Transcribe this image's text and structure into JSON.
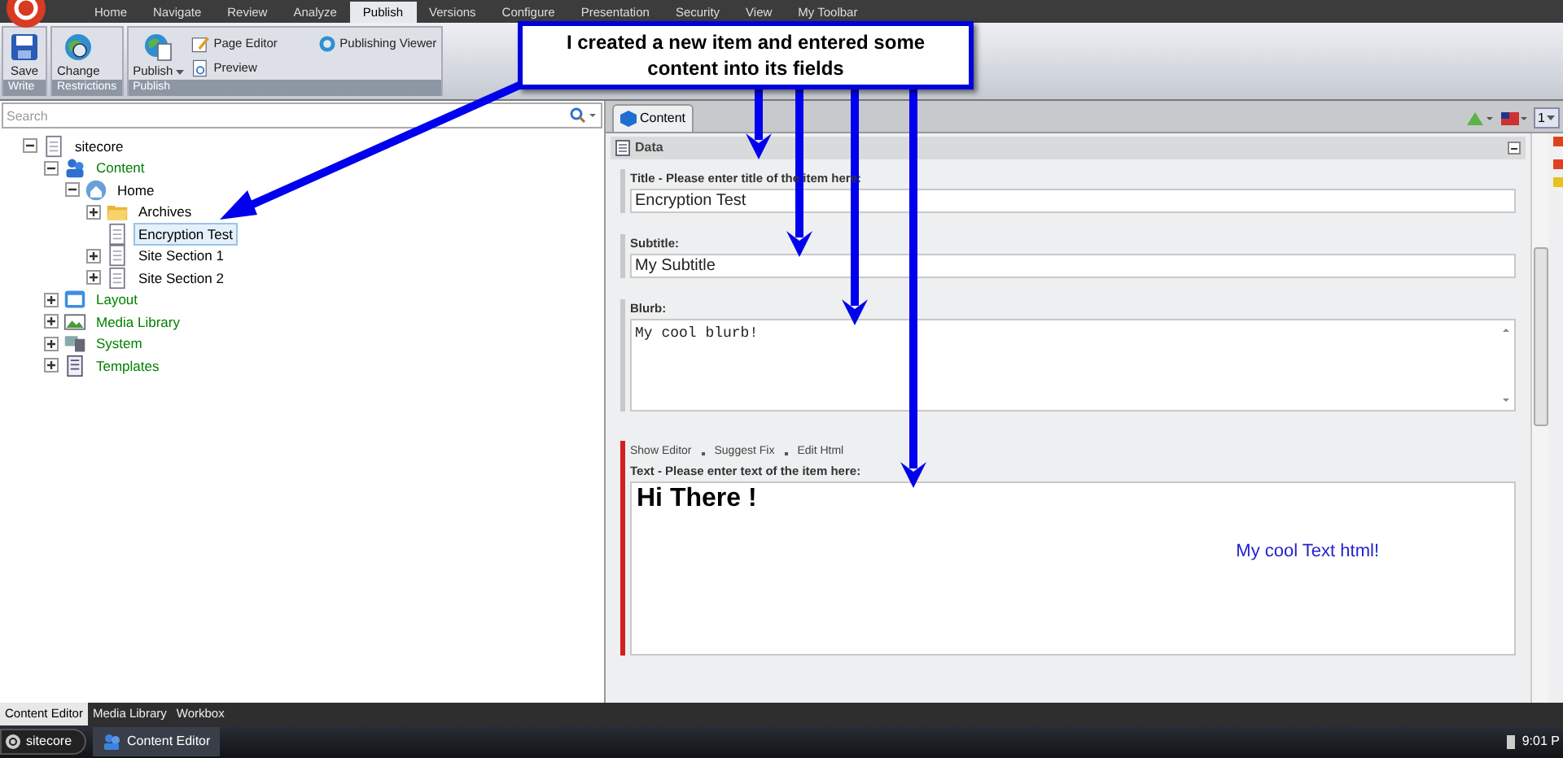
{
  "menu_tabs": [
    {
      "label": "Home",
      "selected": false
    },
    {
      "label": "Navigate",
      "selected": false
    },
    {
      "label": "Review",
      "selected": false
    },
    {
      "label": "Analyze",
      "selected": false
    },
    {
      "label": "Publish",
      "selected": true
    },
    {
      "label": "Versions",
      "selected": false
    },
    {
      "label": "Configure",
      "selected": false
    },
    {
      "label": "Presentation",
      "selected": false
    },
    {
      "label": "Security",
      "selected": false
    },
    {
      "label": "View",
      "selected": false
    },
    {
      "label": "My Toolbar",
      "selected": false
    }
  ],
  "ribbon_groups": [
    {
      "title": "Write",
      "buttons": [
        {
          "label": "Save",
          "kind": "save"
        }
      ]
    },
    {
      "title": "Restrictions",
      "buttons": [
        {
          "label": "Change",
          "kind": "globe"
        }
      ]
    },
    {
      "title": "Publish",
      "buttons": [
        {
          "label": "Publish",
          "kind": "publish",
          "dropdown": true
        }
      ],
      "small_buttons": [
        {
          "label": "Page Editor",
          "kind": "edit"
        },
        {
          "label": "Preview",
          "kind": "preview"
        },
        {
          "label": "Publishing Viewer",
          "kind": "viewer"
        }
      ]
    }
  ],
  "callout": "I created a new item and entered some content into its fields",
  "search": {
    "placeholder": "Search"
  },
  "tree": [
    {
      "label": "sitecore",
      "kind": "page",
      "color": "#000000",
      "expanded": true,
      "selected": false,
      "children": [
        {
          "label": "Content",
          "kind": "content",
          "color": "#008000",
          "expanded": true,
          "selected": false,
          "children": [
            {
              "label": "Home",
              "kind": "home",
              "color": "#000000",
              "expanded": true,
              "selected": false,
              "children": [
                {
                  "label": "Archives",
                  "kind": "folder",
                  "color": "#000000",
                  "expanded": false,
                  "selected": false
                },
                {
                  "label": "Encryption Test",
                  "kind": "page",
                  "color": "#000000",
                  "selected": true
                },
                {
                  "label": "Site Section 1",
                  "kind": "page",
                  "color": "#000000",
                  "expanded": false,
                  "selected": false
                },
                {
                  "label": "Site Section 2",
                  "kind": "page",
                  "color": "#000000",
                  "expanded": false,
                  "selected": false
                }
              ]
            }
          ]
        },
        {
          "label": "Layout",
          "kind": "layout",
          "color": "#008000",
          "expanded": false,
          "selected": false
        },
        {
          "label": "Media Library",
          "kind": "media",
          "color": "#008000",
          "expanded": false,
          "selected": false
        },
        {
          "label": "System",
          "kind": "system",
          "color": "#008000",
          "expanded": false,
          "selected": false
        },
        {
          "label": "Templates",
          "kind": "templates",
          "color": "#008000",
          "expanded": false,
          "selected": false
        }
      ]
    }
  ],
  "editor_tab": "Content",
  "version_button": "1",
  "section": {
    "title": "Data",
    "expanded": true
  },
  "fields": [
    {
      "kind": "text",
      "label": "Title - Please enter title of the item here:",
      "value": "Encryption Test"
    },
    {
      "kind": "text",
      "label": "Subtitle:",
      "value": "My Subtitle"
    },
    {
      "kind": "memo",
      "label": "Blurb:",
      "value": "My cool blurb!"
    },
    {
      "kind": "rich",
      "label": "Text - Please enter text of the item here:",
      "invalid": true,
      "links": [
        "Show Editor",
        "Suggest Fix",
        "Edit Html"
      ],
      "heading": "Hi There !",
      "body": "My cool Text html!"
    }
  ],
  "bottom_tabs": [
    {
      "label": "Content Editor",
      "selected": true
    },
    {
      "label": "Media Library",
      "selected": false
    },
    {
      "label": "Workbox",
      "selected": false
    }
  ],
  "taskbar": {
    "start": "sitecore",
    "apps": [
      "Content Editor"
    ],
    "clock": "9:01 P"
  }
}
